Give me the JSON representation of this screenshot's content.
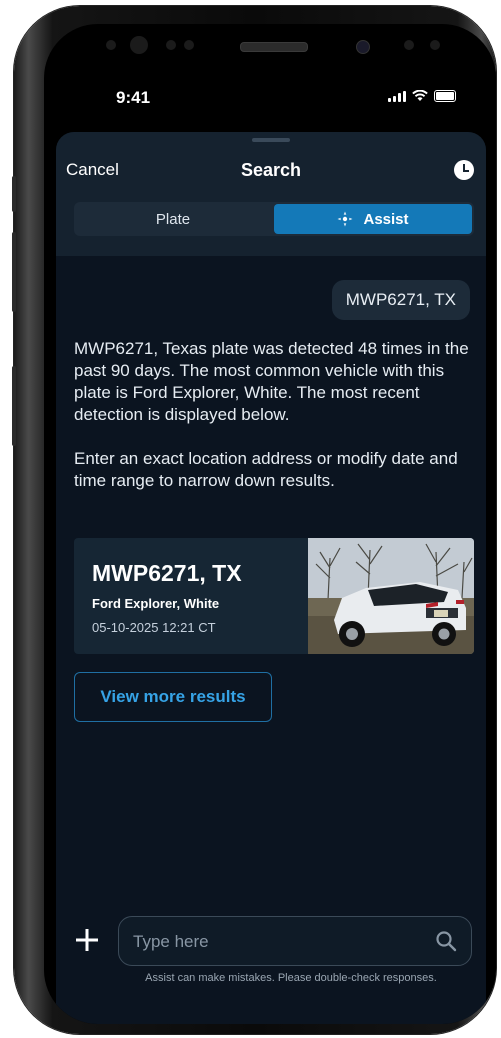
{
  "status": {
    "time": "9:41"
  },
  "header": {
    "cancel_label": "Cancel",
    "title": "Search",
    "history_icon": "clock-icon"
  },
  "tabs": [
    {
      "label": "Plate",
      "active": false
    },
    {
      "label": "Assist",
      "active": true,
      "icon": "sparkle-icon"
    }
  ],
  "chat": {
    "user_query": "MWP6271, TX",
    "reply_paragraphs": [
      "MWP6271, Texas plate was detected 48 times in the past 90 days. The most common vehicle with this plate is Ford Explorer, White. The most recent detection is displayed below.",
      "Enter an exact location address or modify date and time range to narrow down results."
    ]
  },
  "result_card": {
    "plate": "MWP6271, TX",
    "vehicle": "Ford Explorer, White",
    "datetime": "05-10-2025 12:21 CT"
  },
  "view_more_label": "View more results",
  "composer": {
    "placeholder": "Type here",
    "disclaimer": "Assist can make mistakes. Please double-check responses."
  },
  "colors": {
    "accent": "#1479b8",
    "link": "#36a3e6",
    "background": "#0b1420"
  }
}
